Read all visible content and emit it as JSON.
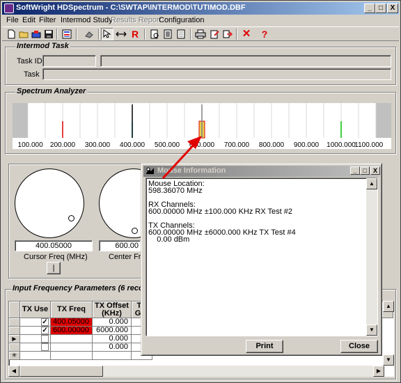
{
  "window": {
    "title": "SoftWright HDSpectrum - C:\\SWTAP\\INTERMOD\\TUTIMOD.DBF",
    "controls": {
      "minimize": "_",
      "maximize": "□",
      "close": "X"
    }
  },
  "menu": {
    "items": [
      "File",
      "Edit",
      "Filter",
      "Intermod Study",
      "Results Report",
      "Configuration"
    ]
  },
  "toolbar": {
    "icons": [
      "new-doc-icon",
      "open-folder-icon",
      "open-db-icon",
      "save-icon",
      "list-icon",
      "tool-icon",
      "pointer-icon",
      "arrows-icon",
      "r-icon",
      "print-preview-icon",
      "page-icon",
      "page2-icon",
      "printer-icon",
      "edit-icon",
      "export-icon",
      "close-x-icon",
      "help-icon"
    ],
    "r_label": "R",
    "x_label": "✕",
    "help_label": "?"
  },
  "intermod_task": {
    "title": "Intermod Task",
    "task_id_label": "Task ID:",
    "task_label": "Task",
    "task_id_value": "",
    "task_value": ""
  },
  "spectrum": {
    "title": "Spectrum Analyzer",
    "ticks": [
      "100.000",
      "200.000",
      "300.000",
      "400.000",
      "500.000",
      "600.000",
      "700.000",
      "800.000",
      "900.000",
      "1000.000",
      "1100.000"
    ],
    "range_mhz": [
      100,
      1100
    ],
    "lines": [
      {
        "freq_mhz": 200,
        "color": "#e00000"
      },
      {
        "freq_mhz": 400,
        "color": "#00e0e0"
      },
      {
        "freq_mhz": 400,
        "color": "#000000",
        "full": true
      },
      {
        "freq_mhz": 600,
        "color": "#808080",
        "full": true
      },
      {
        "freq_mhz": 1000,
        "color": "#00c000"
      }
    ],
    "highlight_freq_mhz": 600
  },
  "knobs": {
    "cursor_value": "400.05000",
    "cursor_label": "Cursor Freq (MHz)",
    "center_value": "600.00",
    "center_label": "Center Freq",
    "toggle_label": "|"
  },
  "freq_params": {
    "title": "Input Frequency Parameters (6 records)",
    "headers": [
      "TX Use",
      "TX Freq",
      "TX Offset (KHz)",
      "TX Gro"
    ],
    "rows": [
      {
        "checked": true,
        "tx_freq": "400.05000",
        "offset": "0.000",
        "highlight": true
      },
      {
        "checked": true,
        "tx_freq": "600.00000",
        "offset": "6000.000",
        "highlight": true
      },
      {
        "checked": false,
        "tx_freq": "",
        "offset": "0.000",
        "highlight": false
      },
      {
        "checked": false,
        "tx_freq": "",
        "offset": "0.000",
        "highlight": false
      }
    ],
    "current_row_marker": "▶",
    "new_row_marker": "✳"
  },
  "dialog": {
    "title": "Mouse Information",
    "text": "Mouse Location:\n598.36070 MHz\n\nRX Channels:\n600.00000 MHz ±100.000 KHz RX Test #2\n\nTX Channels:\n600.00000 MHz ±6000.000 KHz TX Test #4\n    0.00 dBm",
    "print_label": "Print",
    "close_label": "Close"
  },
  "colors": {
    "highlight_cell": "#e00000",
    "arrow": "#e00000"
  }
}
